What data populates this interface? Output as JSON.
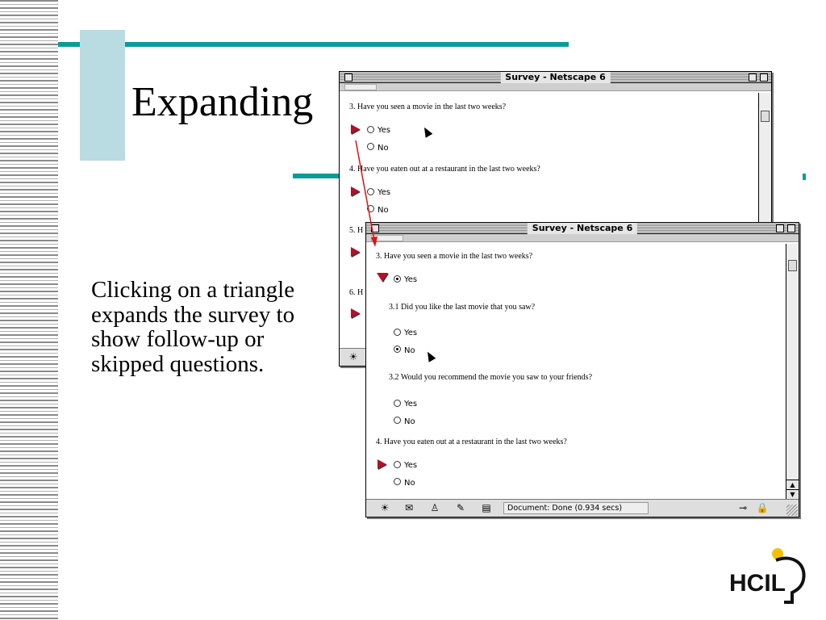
{
  "slide": {
    "title": "Expanding",
    "body": "Clicking on a triangle expands the survey to show follow-up or skipped questions.",
    "logo_text": "HCIL"
  },
  "window_back": {
    "title": "Survey - Netscape 6",
    "questions": [
      {
        "text": "3. Have you seen a movie in the last two weeks?",
        "options": [
          "Yes",
          "No"
        ]
      },
      {
        "text": "4. Have you eaten out at a restaurant in the last two weeks?",
        "options": [
          "Yes",
          "No"
        ]
      },
      {
        "text": "5. H"
      },
      {
        "text": "6. H"
      }
    ]
  },
  "window_front": {
    "title": "Survey - Netscape 6",
    "q3": {
      "text": "3. Have you seen a movie in the last two weeks?",
      "option_yes": "Yes"
    },
    "q3_1": {
      "text": "3.1 Did you like the last movie that you saw?",
      "option_yes": "Yes",
      "option_no": "No"
    },
    "q3_2": {
      "text": "3.2 Would you recommend the movie you saw to your friends?",
      "option_yes": "Yes",
      "option_no": "No"
    },
    "q4": {
      "text": "4. Have you eaten out at a restaurant in the last two weeks?",
      "option_yes": "Yes",
      "option_no": "No"
    },
    "status": "Document: Done (0.934 secs)"
  },
  "colors": {
    "accent_teal": "#0e9a99",
    "accent_light": "#b9dce2",
    "triangle_red": "#b1102a",
    "arrow_red": "#e01010"
  },
  "icons": [
    "close-box-icon",
    "zoom-box-icon",
    "collapse-box-icon",
    "expand-triangle-icon",
    "collapse-triangle-icon",
    "mouse-cursor-icon",
    "scroll-up-arrow-icon",
    "scroll-down-arrow-icon",
    "network-icon",
    "security-lock-icon"
  ]
}
